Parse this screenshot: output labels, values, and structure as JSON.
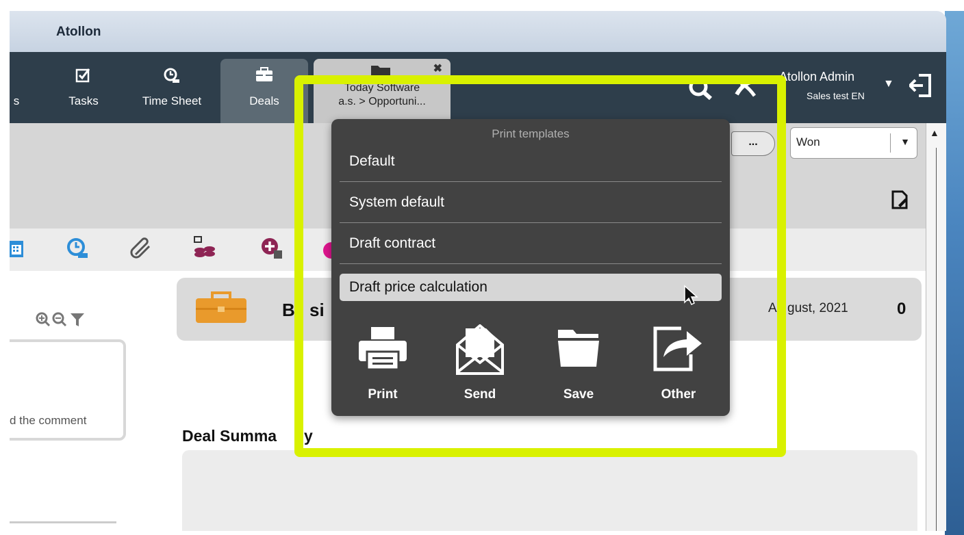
{
  "app": {
    "title": "Atollon"
  },
  "nav": {
    "partial_label": "s",
    "items": [
      {
        "label": "Tasks",
        "icon": "checkbox-icon"
      },
      {
        "label": "Time Sheet",
        "icon": "clock-user-icon"
      },
      {
        "label": "Deals",
        "icon": "briefcase-icon"
      }
    ],
    "doc_tab": {
      "line1": "Today Software",
      "line2": "a.s. > Opportuni...",
      "close": "✖"
    }
  },
  "user": {
    "name": "Atollon Admin",
    "sub": "Sales test EN",
    "arrow": "▼"
  },
  "toolbar": {
    "status_value": "Won",
    "status_arrow": "▼",
    "more_label": "...",
    "scroll_up": "▲"
  },
  "deal": {
    "name_partial": "B",
    "name_partial2": "si",
    "date": "August, 2021",
    "date_partial": "A",
    "date_partial2": "gust, 2021",
    "amount": "0"
  },
  "comment_partial": "d the comment",
  "summary": {
    "title": "Deal Summa",
    "title_tail": "y"
  },
  "popup": {
    "title": "Print templates",
    "templates": [
      "Default",
      "System default",
      "Draft contract",
      "Draft price calculation"
    ],
    "actions": [
      {
        "label": "Print",
        "icon": "printer-icon"
      },
      {
        "label": "Send",
        "icon": "envelope-icon"
      },
      {
        "label": "Save",
        "icon": "folder-icon"
      },
      {
        "label": "Other",
        "icon": "share-icon"
      }
    ]
  },
  "colors": {
    "highlight": "#d9f100",
    "navbar": "#2e3e4b",
    "popup_bg": "#424242",
    "accent_orange": "#e99a2c"
  }
}
